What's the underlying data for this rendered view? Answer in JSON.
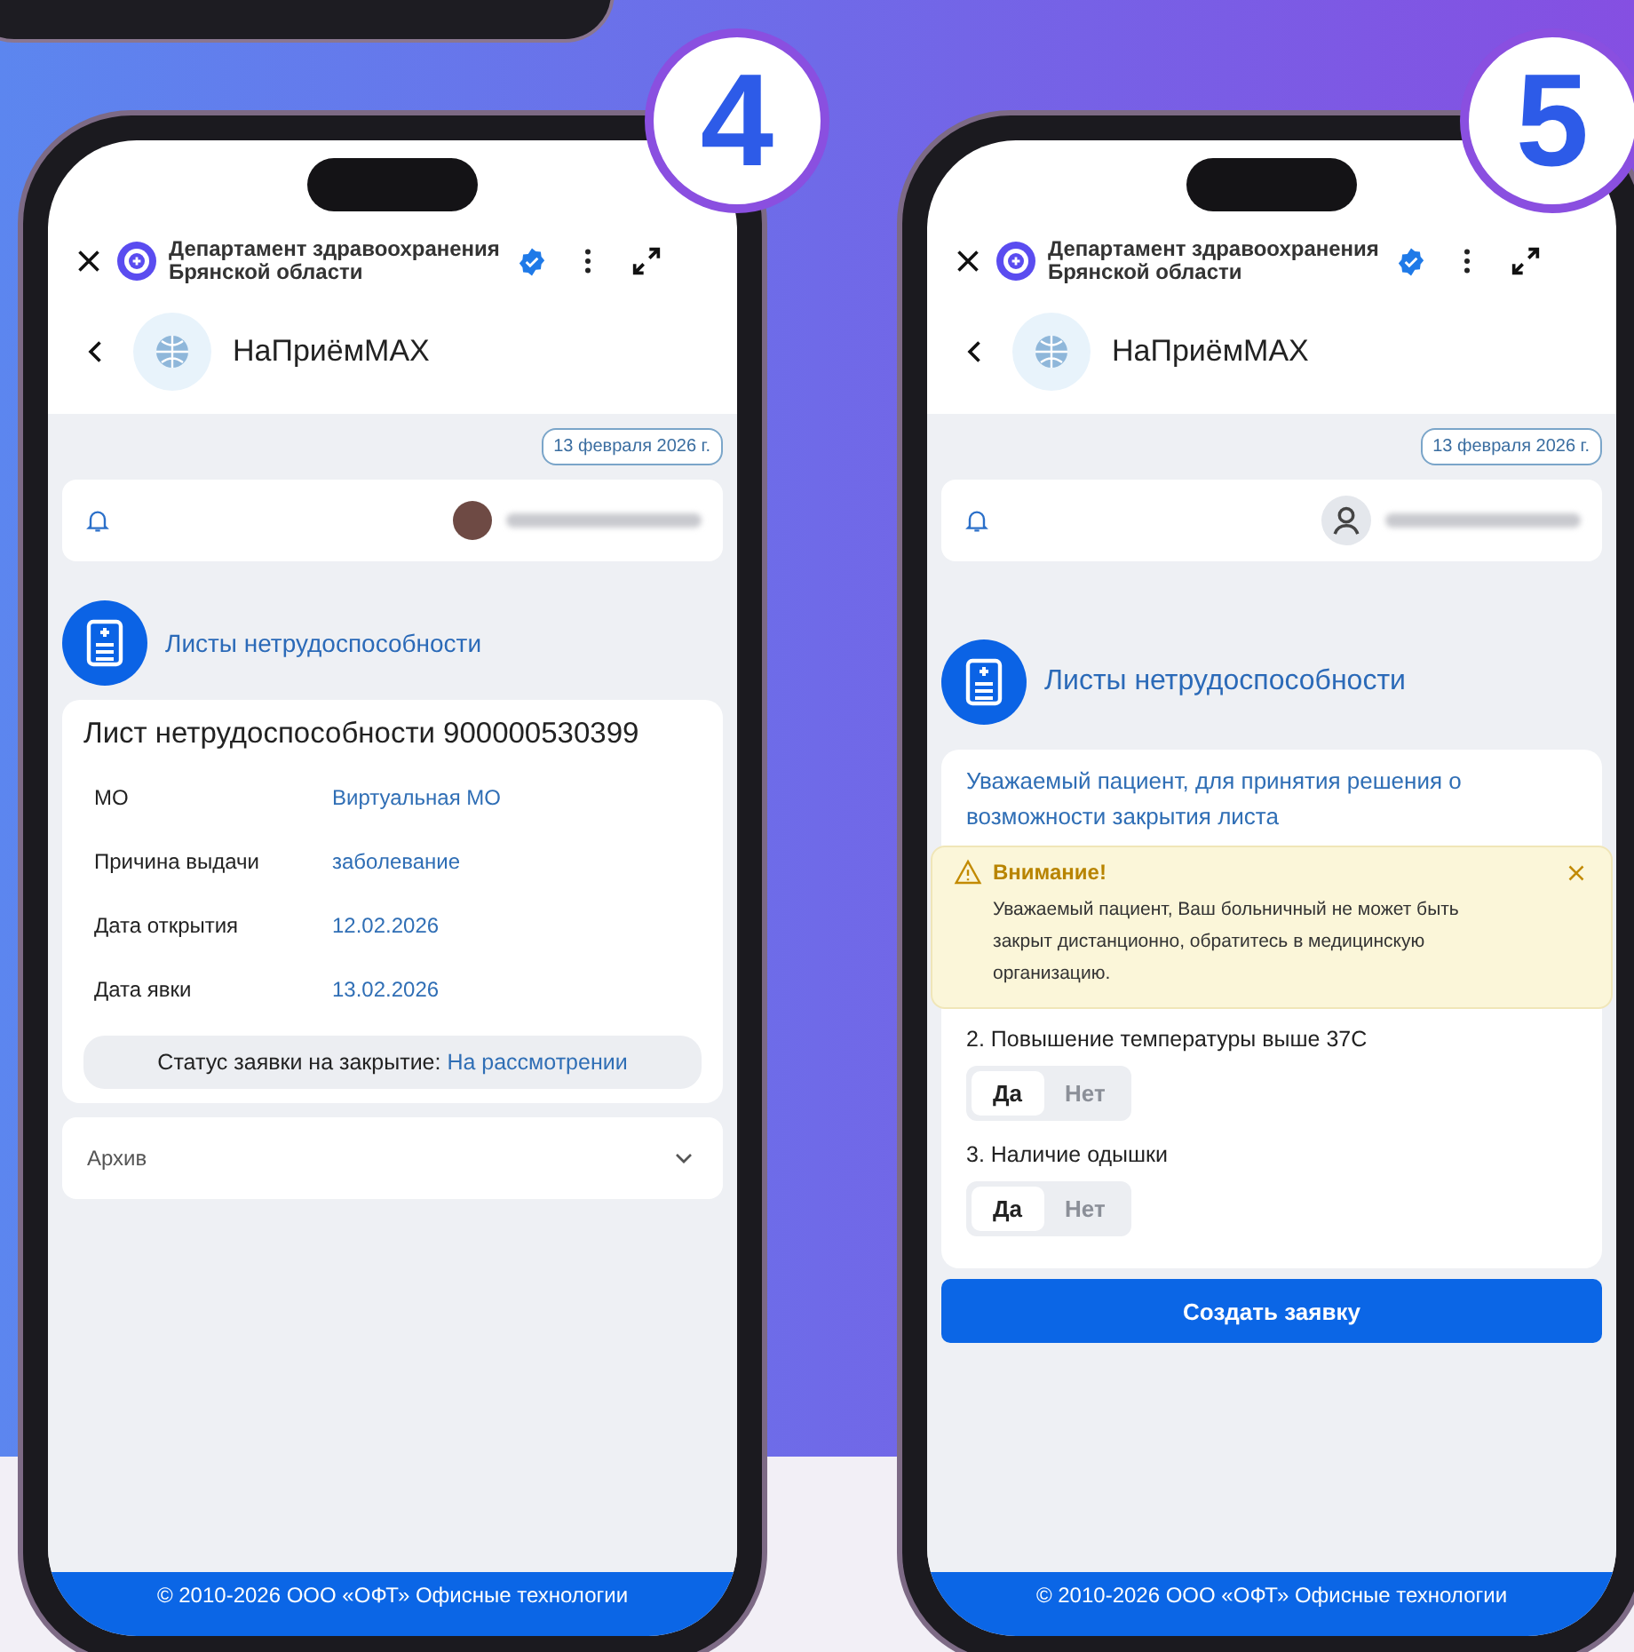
{
  "phones": [
    {
      "step": "4",
      "kind": "sick_leave_list",
      "header": {
        "title_lines": [
          "Департамент здравоохранения",
          "Брянской области"
        ],
        "verified": true
      },
      "app_title": "НаПриёмMAX",
      "date": "13 февраля 2026 г.",
      "user": {
        "kind": "photo"
      },
      "section_title": "Листы нетрудоспособности",
      "card": {
        "title": "Лист нетрудоспособности 900000530399",
        "fields": [
          {
            "label": "МО",
            "value": "Виртуальная МО"
          },
          {
            "label": "Причина выдачи",
            "value": "заболевание"
          },
          {
            "label": "Дата открытия",
            "value": "12.02.2026"
          },
          {
            "label": "Дата явки",
            "value": "13.02.2026"
          }
        ],
        "status_label": "Статус заявки на закрытие:",
        "status_value": "На рассмотрении"
      },
      "archive": {
        "label": "Архив",
        "expanded": false
      },
      "footer": "© 2010-2026 ООО «ОФТ» Офисные технологии"
    },
    {
      "step": "5",
      "kind": "close_request",
      "header": {
        "title_lines": [
          "Департамент здравоохранения",
          "Брянской области"
        ],
        "verified": true
      },
      "app_title": "НаПриёмMAX",
      "date": "13 февраля 2026 г.",
      "user": {
        "kind": "generic"
      },
      "section_title": "Листы нетрудоспособности",
      "intro": "Уважаемый пациент, для принятия решения о возможности закрытия листа",
      "alert": {
        "title": "Внимание!",
        "text": "Уважаемый пациент, Ваш больничный не может быть закрыт дистанционно, обратитесь в медицинскую организацию."
      },
      "questions": [
        {
          "text": "2. Повышение температуры выше 37С",
          "options": [
            {
              "label": "Да",
              "selected": true
            },
            {
              "label": "Нет",
              "selected": false
            }
          ]
        },
        {
          "text": "3. Наличие одышки",
          "options": [
            {
              "label": "Да",
              "selected": true
            },
            {
              "label": "Нет",
              "selected": false
            }
          ]
        }
      ],
      "button": "Создать заявку",
      "footer": "© 2010-2026 ООО «ОФТ» Офисные технологии"
    }
  ]
}
